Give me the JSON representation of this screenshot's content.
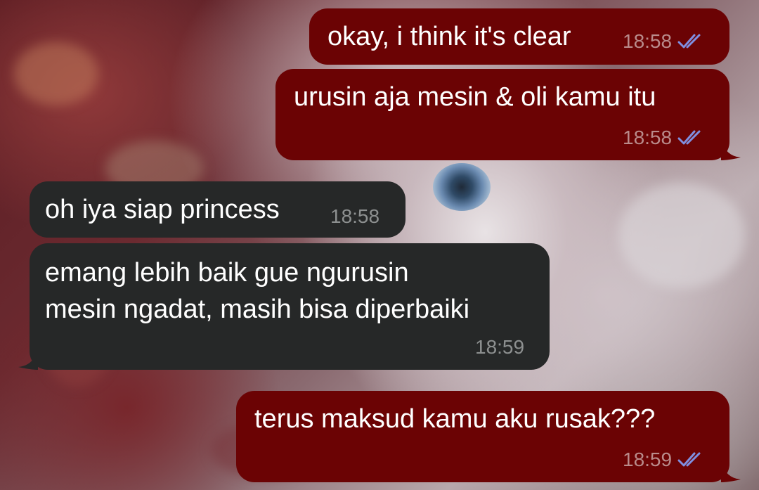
{
  "colors": {
    "outgoing_bubble": "#6b0304",
    "incoming_bubble": "#262828",
    "text": "#ffffff",
    "read_ticks": "#7f8fe0"
  },
  "messages": [
    {
      "direction": "outgoing",
      "text": "okay, i think it's clear",
      "time": "18:58",
      "status": "read-double-check-icon"
    },
    {
      "direction": "outgoing",
      "text": "urusin aja mesin & oli kamu itu",
      "time": "18:58",
      "status": "read-double-check-icon"
    },
    {
      "direction": "incoming",
      "text": "oh iya siap princess",
      "time": "18:58"
    },
    {
      "direction": "incoming",
      "lines": [
        "emang lebih baik gue ngurusin",
        "mesin ngadat, masih bisa diperbaiki"
      ],
      "time": "18:59"
    },
    {
      "direction": "outgoing",
      "text": "terus maksud kamu aku rusak???",
      "time": "18:59",
      "status": "read-double-check-icon"
    }
  ]
}
